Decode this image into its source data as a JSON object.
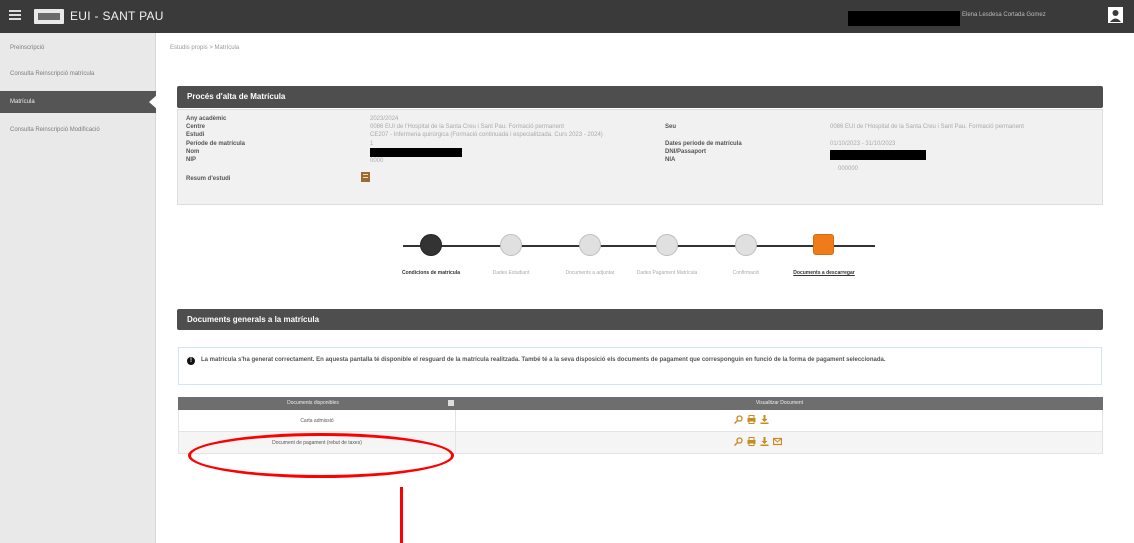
{
  "topbar": {
    "app_title": "EUI - SANT PAU",
    "user_name": "Elena Lesdesa Cortada Gomez"
  },
  "sidebar": {
    "items": [
      {
        "label": "Preinscripció"
      },
      {
        "label": "Consulta Reinscripció matrícula"
      },
      {
        "label": "Matrícula"
      },
      {
        "label": "Consulta Reinscripció Modificació"
      }
    ]
  },
  "breadcrumb": "Estudis propis > Matrícula",
  "process_panel": {
    "title": "Procés d'alta de Matrícula",
    "fields": {
      "any_label": "Any acadèmic",
      "any_value": "2023/2024",
      "centre_label": "Centre",
      "centre_value": "0086 EUI de l'Hospital de la Santa Creu i Sant Pau. Formació permanent",
      "estudi_label": "Estudi",
      "estudi_value": "CE207 - Infermeria quirúrgica (Formació continuada i especialitzada. Curs 2023 - 2024)",
      "periode_label": "Període de matrícula",
      "periode_value": "1",
      "nom_label": "Nom",
      "nip_label": "NIP",
      "nip_value": "0000",
      "resum_label": "Resum d'estudi",
      "seu_label": "Seu",
      "seu_value": "0086 EUI de l'Hospital de la Santa Creu i Sant Pau. Formació permanent",
      "dates_label": "Dates període de matrícula",
      "dates_value": "01/10/2023 - 31/10/2023",
      "dni_label": "DNI/Passaport",
      "nia_label": "NIA",
      "nia_value": "000000"
    }
  },
  "stepper": {
    "steps": [
      {
        "label": "Condicions de matrícula",
        "state": "done"
      },
      {
        "label": "Dades Estudiant",
        "state": "pending"
      },
      {
        "label": "Documents a adjuntar",
        "state": "pending"
      },
      {
        "label": "Dades Pagament Matrícula",
        "state": "pending"
      },
      {
        "label": "Confirmació",
        "state": "pending"
      },
      {
        "label": "Documents a descarregar",
        "state": "current"
      }
    ]
  },
  "documents_panel": {
    "title": "Documents generals a la matrícula",
    "alert_icon": "info-icon",
    "alert_text": "La matrícula s'ha generat correctament. En aquesta pantalla té disponible el resguard de la matrícula realitzada. També té a la seva disposició els documents de pagament que corresponguin en funció de la forma de pagament seleccionada.",
    "table": {
      "headers": [
        "Documents disponibles",
        "Visualitzar Document"
      ],
      "rows": [
        {
          "document": "Carta admissió",
          "actions": [
            "view-icon",
            "print-icon",
            "download-icon"
          ]
        },
        {
          "document": "Document de pagament (rebut de taxes)",
          "actions": [
            "view-icon",
            "print-icon",
            "download-icon",
            "email-icon"
          ]
        }
      ]
    }
  },
  "colors": {
    "topbar": "#3a3a3a",
    "panel_header": "#4e4e4e",
    "current_step": "#f07b1a",
    "annotation": "#ff0000"
  }
}
